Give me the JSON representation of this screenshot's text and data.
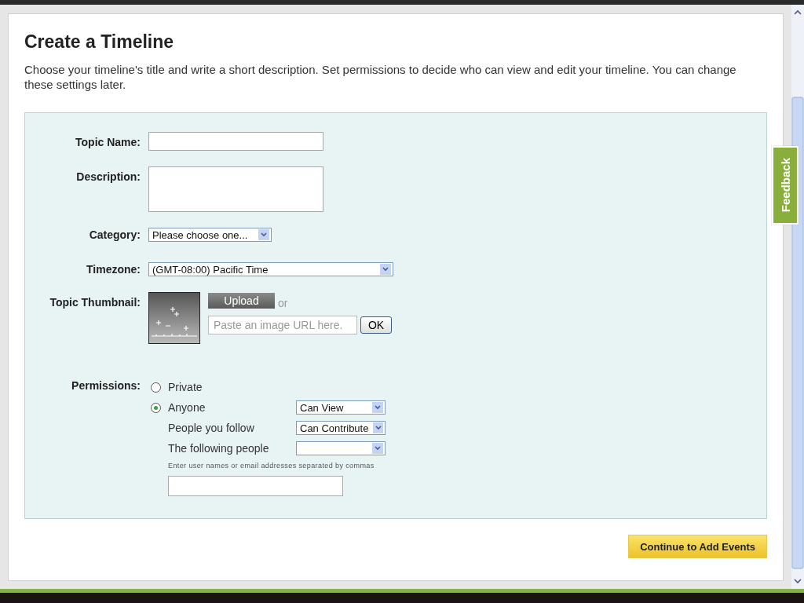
{
  "dialog": {
    "title": "Create a Timeline",
    "description": "Choose your timeline's title and write a short description. Set permissions to decide who can view and edit your timeline. You can change these settings later."
  },
  "form": {
    "topic_name": {
      "label": "Topic Name:"
    },
    "description": {
      "label": "Description:"
    },
    "category": {
      "label": "Category:",
      "value": "Please choose one..."
    },
    "timezone": {
      "label": "Timezone:",
      "value": "(GMT-08:00) Pacific Time"
    },
    "thumbnail": {
      "label": "Topic Thumbnail:",
      "upload": "Upload",
      "or": "or",
      "url_placeholder": "Paste an image URL here.",
      "ok": "OK"
    },
    "permissions": {
      "label": "Permissions:",
      "rows": [
        {
          "kind": "radio",
          "label": "Private",
          "selected": false
        },
        {
          "kind": "radio_select",
          "label": "Anyone",
          "selected": true,
          "access": "Can View"
        },
        {
          "kind": "select",
          "label": "People you follow",
          "access": "Can Contribute"
        },
        {
          "kind": "select",
          "label": "The following people"
        }
      ],
      "hint": "Enter user names or email addresses separated by commas"
    }
  },
  "continue_button": "Continue to Add Events",
  "feedback_tab": "Feedback"
}
